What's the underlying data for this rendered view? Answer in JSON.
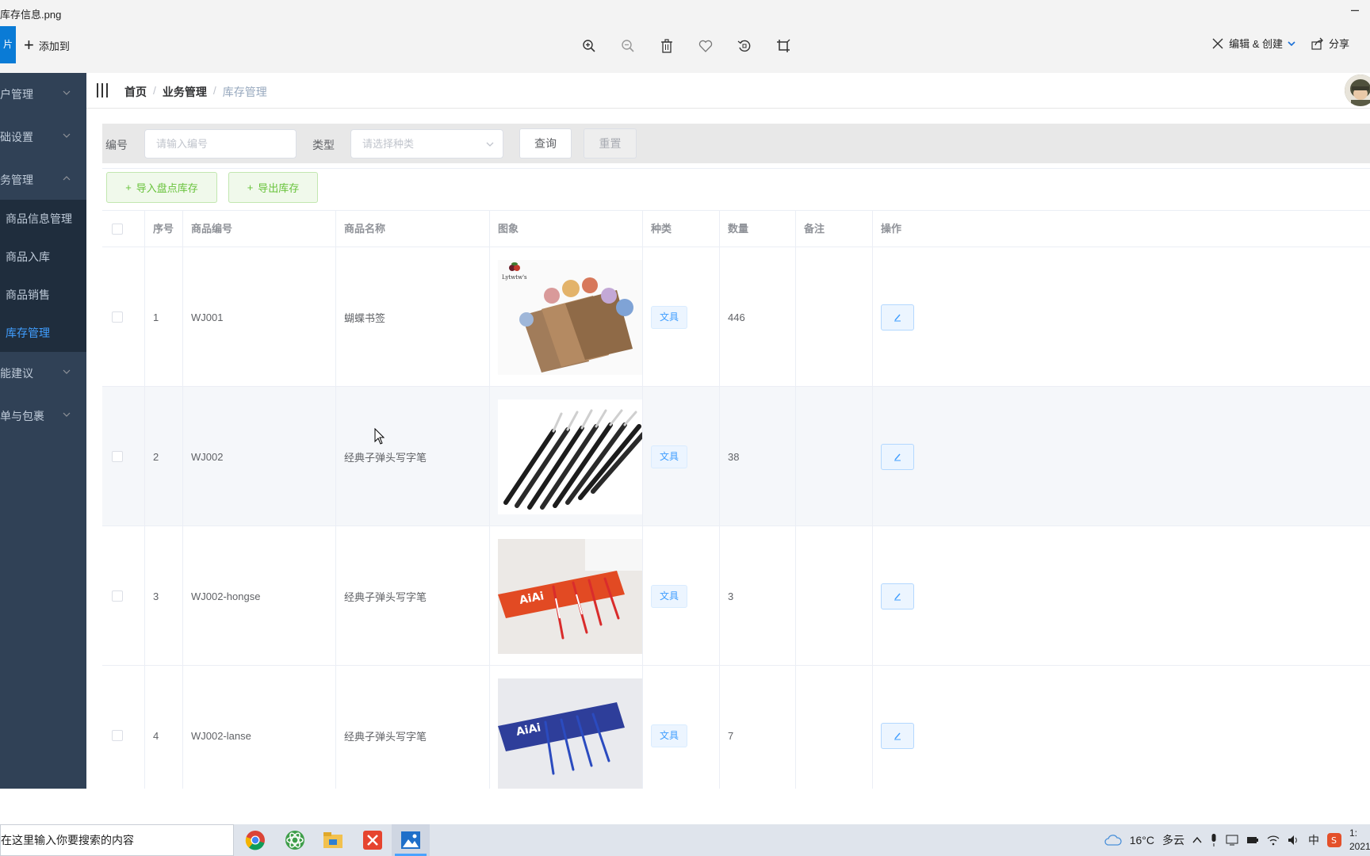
{
  "window": {
    "title": "库存信息.png",
    "minimize_glyph": "–",
    "left_tab_text": "片",
    "add_label": "添加到",
    "edit_create_label": "编辑 & 创建",
    "share_label": "分享",
    "tool_icons": [
      "zoom-in-icon",
      "zoom-out-icon",
      "delete-icon",
      "heart-icon",
      "rotate-icon",
      "crop-icon"
    ]
  },
  "sidebar": {
    "items": [
      {
        "label": "户管理",
        "expanded": false
      },
      {
        "label": "础设置",
        "expanded": false
      },
      {
        "label": "务管理",
        "expanded": true
      },
      {
        "label": "能建议",
        "expanded": false
      },
      {
        "label": "单与包裹",
        "expanded": false
      }
    ],
    "subitems": [
      {
        "label": "商品信息管理",
        "active": false
      },
      {
        "label": "商品入库",
        "active": false
      },
      {
        "label": "商品销售",
        "active": false
      },
      {
        "label": "库存管理",
        "active": true
      }
    ]
  },
  "breadcrumb": {
    "home": "首页",
    "section": "业务管理",
    "current": "库存管理",
    "separator": "/"
  },
  "search": {
    "code_label": "编号",
    "code_placeholder": "请输入编号",
    "type_label": "类型",
    "type_placeholder": "请选择种类",
    "query_label": "查询",
    "reset_label": "重置"
  },
  "actions": {
    "import_label": "导入盘点库存",
    "export_label": "导出库存"
  },
  "table": {
    "headers": {
      "index": "序号",
      "code": "商品编号",
      "name": "商品名称",
      "image": "图象",
      "category": "种类",
      "quantity": "数量",
      "remark": "备注",
      "operation": "操作"
    },
    "rows": [
      {
        "index": "1",
        "code": "WJ001",
        "name": "蝴蝶书签",
        "category": "文具",
        "quantity": "446",
        "remark": "",
        "image_brand": "Lytwtw's"
      },
      {
        "index": "2",
        "code": "WJ002",
        "name": "经典子弹头写字笔",
        "category": "文具",
        "quantity": "38",
        "remark": ""
      },
      {
        "index": "3",
        "code": "WJ002-hongse",
        "name": "经典子弹头写字笔",
        "category": "文具",
        "quantity": "3",
        "remark": "",
        "image_brand": "AiAi"
      },
      {
        "index": "4",
        "code": "WJ002-lanse",
        "name": "经典子弹头写字笔",
        "category": "文具",
        "quantity": "7",
        "remark": "",
        "image_brand": "AiAi"
      }
    ]
  },
  "taskbar": {
    "search_placeholder": "在这里输入你要搜索的内容",
    "weather_temp": "16°C",
    "weather_desc": "多云",
    "ime_label": "中",
    "clock_time": "1:",
    "clock_date": "2021",
    "apps": [
      "chrome-icon",
      "atom-icon",
      "file-explorer-icon",
      "xmind-icon",
      "photos-icon"
    ]
  },
  "colors": {
    "sidebar_bg": "#304156",
    "sidebar_sub_bg": "#1f2d3d",
    "accent": "#409eff",
    "success": "#67c23a"
  }
}
